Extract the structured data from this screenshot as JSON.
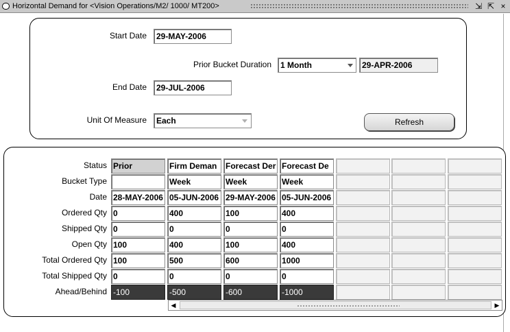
{
  "window": {
    "title": "Horizontal Demand for <Vision Operations/M2/ 1000/ MT200>",
    "buttons": {
      "minimize": "⇲",
      "maximize": "⇱",
      "close": "×"
    }
  },
  "params": {
    "start_date_label": "Start Date",
    "start_date": "29-MAY-2006",
    "prior_bucket_label": "Prior Bucket Duration",
    "prior_bucket_value": "1 Month",
    "prior_bucket_date": "29-APR-2006",
    "end_date_label": "End Date",
    "end_date": "29-JUL-2006",
    "uom_label": "Unit Of Measure",
    "uom_value": "Each",
    "refresh_label": "Refresh"
  },
  "grid": {
    "row_labels": {
      "status": "Status",
      "bucket_type": "Bucket Type",
      "date": "Date",
      "ordered_qty": "Ordered Qty",
      "shipped_qty": "Shipped Qty",
      "open_qty": "Open Qty",
      "total_ordered_qty": "Total Ordered Qty",
      "total_shipped_qty": "Total Shipped Qty",
      "ahead_behind": "Ahead/Behind"
    },
    "columns": [
      {
        "status": "Prior",
        "bucket_type": "",
        "date": "28-MAY-2006",
        "ordered_qty": "0",
        "shipped_qty": "0",
        "open_qty": "100",
        "total_ordered_qty": "100",
        "total_shipped_qty": "0",
        "ahead_behind": "-100"
      },
      {
        "status": "Firm Deman",
        "bucket_type": "Week",
        "date": "05-JUN-2006",
        "ordered_qty": "400",
        "shipped_qty": "0",
        "open_qty": "400",
        "total_ordered_qty": "500",
        "total_shipped_qty": "0",
        "ahead_behind": "-500"
      },
      {
        "status": "Forecast Der",
        "bucket_type": "Week",
        "date": "29-MAY-2006",
        "ordered_qty": "100",
        "shipped_qty": "0",
        "open_qty": "100",
        "total_ordered_qty": "600",
        "total_shipped_qty": "0",
        "ahead_behind": "-600"
      },
      {
        "status": "Forecast De",
        "bucket_type": "Week",
        "date": "05-JUN-2006",
        "ordered_qty": "400",
        "shipped_qty": "0",
        "open_qty": "400",
        "total_ordered_qty": "1000",
        "total_shipped_qty": "0",
        "ahead_behind": "-1000"
      }
    ]
  }
}
